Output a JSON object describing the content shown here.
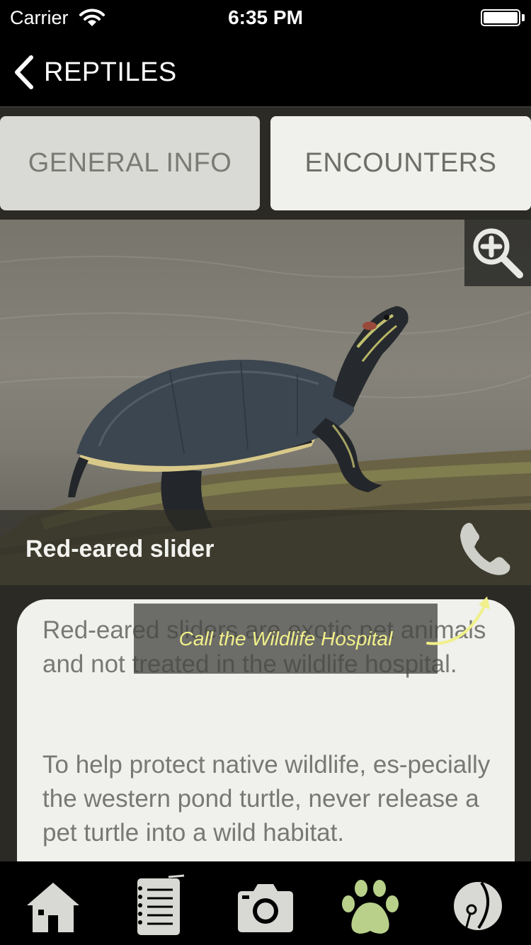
{
  "status_bar": {
    "carrier": "Carrier",
    "time": "6:35 PM"
  },
  "nav": {
    "back_label": "REPTILES"
  },
  "tabs": [
    {
      "label": "GENERAL INFO",
      "selected": true
    },
    {
      "label": "ENCOUNTERS",
      "selected": false
    }
  ],
  "photo": {
    "caption": "Red-eared slider",
    "zoom_icon": "zoom-in-icon",
    "call_icon": "phone-icon"
  },
  "content": {
    "paragraph_1": "Red-eared sliders are exotic pet animals and not treated in the wildlife hospital.",
    "paragraph_2": "To help protect native wildlife, es-pecially the western pond turtle, never release a pet turtle into a wild habitat."
  },
  "tooltip": {
    "text": "Call the Wildlife Hospital"
  },
  "tab_bar": {
    "items": [
      "home-icon",
      "notes-icon",
      "camera-icon",
      "paw-icon",
      "wildlife-logo-icon"
    ],
    "active_index": 3,
    "active_color": "#b8d08a",
    "inactive_color": "#d8d8d4"
  }
}
